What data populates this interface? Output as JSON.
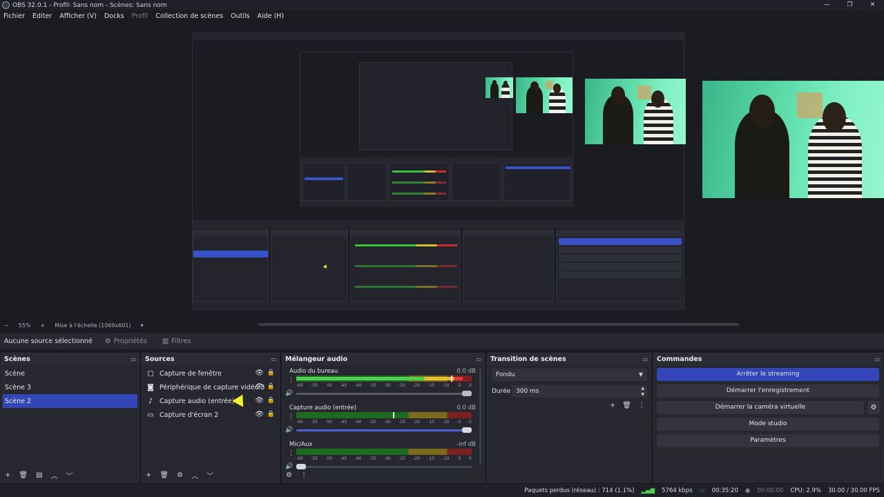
{
  "window": {
    "title": "OBS 32.0.1 - Profil: Sans nom - Scènes: Sans nom",
    "controls": {
      "minimize": "—",
      "maximize": "❐",
      "close": "✕"
    }
  },
  "menu": {
    "items": [
      "Fichier",
      "Editer",
      "Afficher (V)",
      "Docks",
      "Profil",
      "Collection de scènes",
      "Outils",
      "Aide (H)"
    ]
  },
  "preview": {
    "zoom_minus": "−",
    "zoom_value": "55%",
    "zoom_plus": "+",
    "scale_mode": "Mise à l'échelle (1069x601)",
    "scale_dropdown": "▾"
  },
  "context": {
    "no_selection": "Aucune source sélectionné",
    "properties_label": "Propriétés",
    "filters_label": "Filtres"
  },
  "scenes": {
    "title": "Scènes",
    "items": [
      "Scène",
      "Scène 3",
      "Scène 2"
    ],
    "selected_index": 2,
    "footer": [
      "+",
      "🗑",
      "▤",
      "︿",
      "﹀"
    ]
  },
  "sources": {
    "title": "Sources",
    "items": [
      {
        "label": "Capture de fenêtre",
        "icon": "window-icon"
      },
      {
        "label": "Périphérique de capture vidéo 3",
        "icon": "camera-icon"
      },
      {
        "label": "Capture audio (entrée)",
        "icon": "microphone-icon"
      },
      {
        "label": "Capture d'écran 2",
        "icon": "monitor-icon"
      }
    ],
    "footer": [
      "+",
      "🗑",
      "⚙",
      "︿",
      "﹀"
    ]
  },
  "mixer": {
    "title": "Mélangeur audio",
    "ticks": [
      "-60",
      "-55",
      "-50",
      "-45",
      "-40",
      "-35",
      "-30",
      "-25",
      "-20",
      "-15",
      "-10",
      "-5",
      "0"
    ],
    "channels": [
      {
        "name": "Audio du bureau",
        "db": "0.0 dB",
        "level": 0.95,
        "peak": 0.88,
        "volume": 1.0,
        "muted_style": true
      },
      {
        "name": "Capture audio (entrée)",
        "db": "0.0 dB",
        "level": 0.0,
        "peak": 0.55,
        "volume": 1.0,
        "muted_style": false
      },
      {
        "name": "Mic/Aux",
        "db": "-inf dB",
        "level": 0.0,
        "peak": 0.0,
        "volume": 0.0,
        "muted_style": false
      }
    ],
    "footer": [
      "⚙",
      "⋮"
    ]
  },
  "transitions": {
    "title": "Transition de scènes",
    "selected": "Fondu",
    "duration_label": "Durée",
    "duration_value": "300 ms",
    "tools": [
      "+",
      "🗑",
      "⋮"
    ]
  },
  "commands": {
    "title": "Commandes",
    "buttons": [
      "Arrêter le streaming",
      "Démarrer l'enregistrement",
      "Démarrer la caméra virtuelle",
      "Mode studio",
      "Paramètres"
    ],
    "gear": "⚙"
  },
  "status": {
    "dropped": "Paquets perdus (réseau) : 714 (1.1%)",
    "bitrate": "5764 kbps",
    "stream_time": "00:35:20",
    "record_time": "00:00:00",
    "cpu": "CPU: 2.9%",
    "fps": "30.00 / 30.00 FPS"
  },
  "accent": "#3346b8"
}
